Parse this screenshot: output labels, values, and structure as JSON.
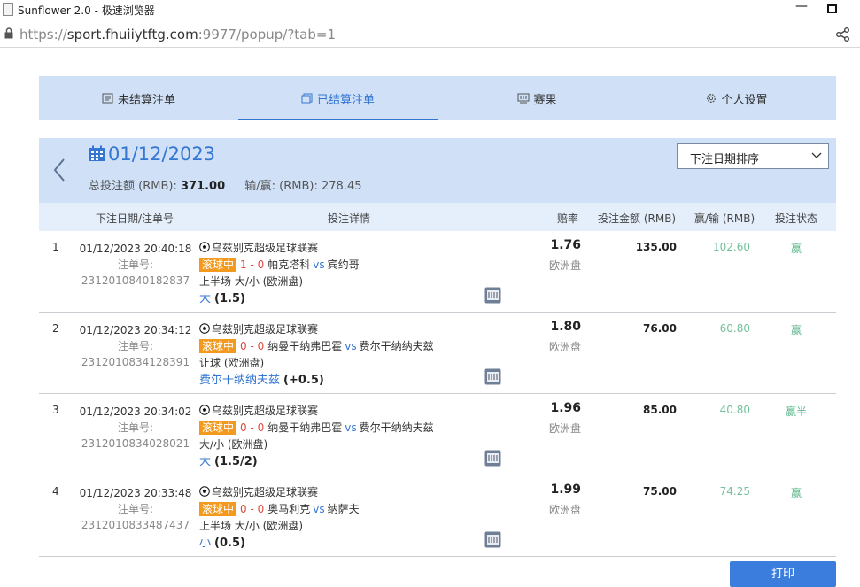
{
  "window": {
    "title": "Sunflower 2.0 - 极速浏览器"
  },
  "address": {
    "scheme": "https://",
    "host": "sport.fhuiiytftg.com",
    "rest": ":9977/popup/?tab=1"
  },
  "tabs": [
    {
      "label": "未结算注单",
      "icon": "bet-slip-icon"
    },
    {
      "label": "已结算注单",
      "icon": "settled-slip-icon",
      "active": true
    },
    {
      "label": "赛果",
      "icon": "results-icon"
    },
    {
      "label": "个人设置",
      "icon": "gear-icon"
    }
  ],
  "summary": {
    "date": "01/12/2023",
    "total_label": "总投注额 (RMB):",
    "total_value": "371.00",
    "winloss_label": "输/赢: (RMB):",
    "winloss_value": "278.45"
  },
  "sort": {
    "selected": "下注日期排序"
  },
  "columns": {
    "date_id": "下注日期/注单号",
    "detail": "投注详情",
    "odds": "赔率",
    "amount": "投注金额 (RMB)",
    "winloss": "赢/输 (RMB)",
    "status": "投注状态"
  },
  "bets": [
    {
      "index": "1",
      "datetime": "01/12/2023 20:40:18",
      "order_label": "注单号:",
      "order_id": "2312010840182837",
      "league": "乌兹别克超级足球联赛",
      "live": "滚球中",
      "score": "1 - 0",
      "home": "帕克塔科",
      "vs": "vs",
      "away": "宾约哥",
      "market_line": "上半场 大/小 (欧洲盘)",
      "pick": "大",
      "pick_line": "(1.5)",
      "odds": "1.76",
      "market": "欧洲盘",
      "amount": "135.00",
      "winloss": "102.60",
      "status": "赢"
    },
    {
      "index": "2",
      "datetime": "01/12/2023 20:34:12",
      "order_label": "注单号:",
      "order_id": "2312010834128391",
      "league": "乌兹别克超级足球联赛",
      "live": "滚球中",
      "score": "0 - 0",
      "home": "纳曼干纳弗巴霍",
      "vs": "vs",
      "away": "费尔干纳纳夫兹",
      "market_line": "让球 (欧洲盘)",
      "pick": "费尔干纳纳夫兹",
      "pick_line": "(+0.5)",
      "odds": "1.80",
      "market": "欧洲盘",
      "amount": "76.00",
      "winloss": "60.80",
      "status": "赢"
    },
    {
      "index": "3",
      "datetime": "01/12/2023 20:34:02",
      "order_label": "注单号:",
      "order_id": "2312010834028021",
      "league": "乌兹别克超级足球联赛",
      "live": "滚球中",
      "score": "0 - 0",
      "home": "纳曼干纳弗巴霍",
      "vs": "vs",
      "away": "费尔干纳纳夫兹",
      "market_line": "大/小 (欧洲盘)",
      "pick": "大",
      "pick_line": "(1.5/2)",
      "odds": "1.96",
      "market": "欧洲盘",
      "amount": "85.00",
      "winloss": "40.80",
      "status": "赢半"
    },
    {
      "index": "4",
      "datetime": "01/12/2023 20:33:48",
      "order_label": "注单号:",
      "order_id": "2312010833487437",
      "league": "乌兹别克超级足球联赛",
      "live": "滚球中",
      "score": "0 - 0",
      "home": "奥马利克",
      "vs": "vs",
      "away": "纳萨夫",
      "market_line": "上半场 大/小 (欧洲盘)",
      "pick": "小",
      "pick_line": "(0.5)",
      "odds": "1.99",
      "market": "欧洲盘",
      "amount": "75.00",
      "winloss": "74.25",
      "status": "赢"
    }
  ],
  "print": {
    "label": "打印"
  },
  "colors": {
    "accent": "#3476d2",
    "panel": "#cfe0f7",
    "live": "#f39a1e",
    "score": "#e04a3a",
    "win": "#74c09a",
    "button": "#3b7ddd"
  }
}
